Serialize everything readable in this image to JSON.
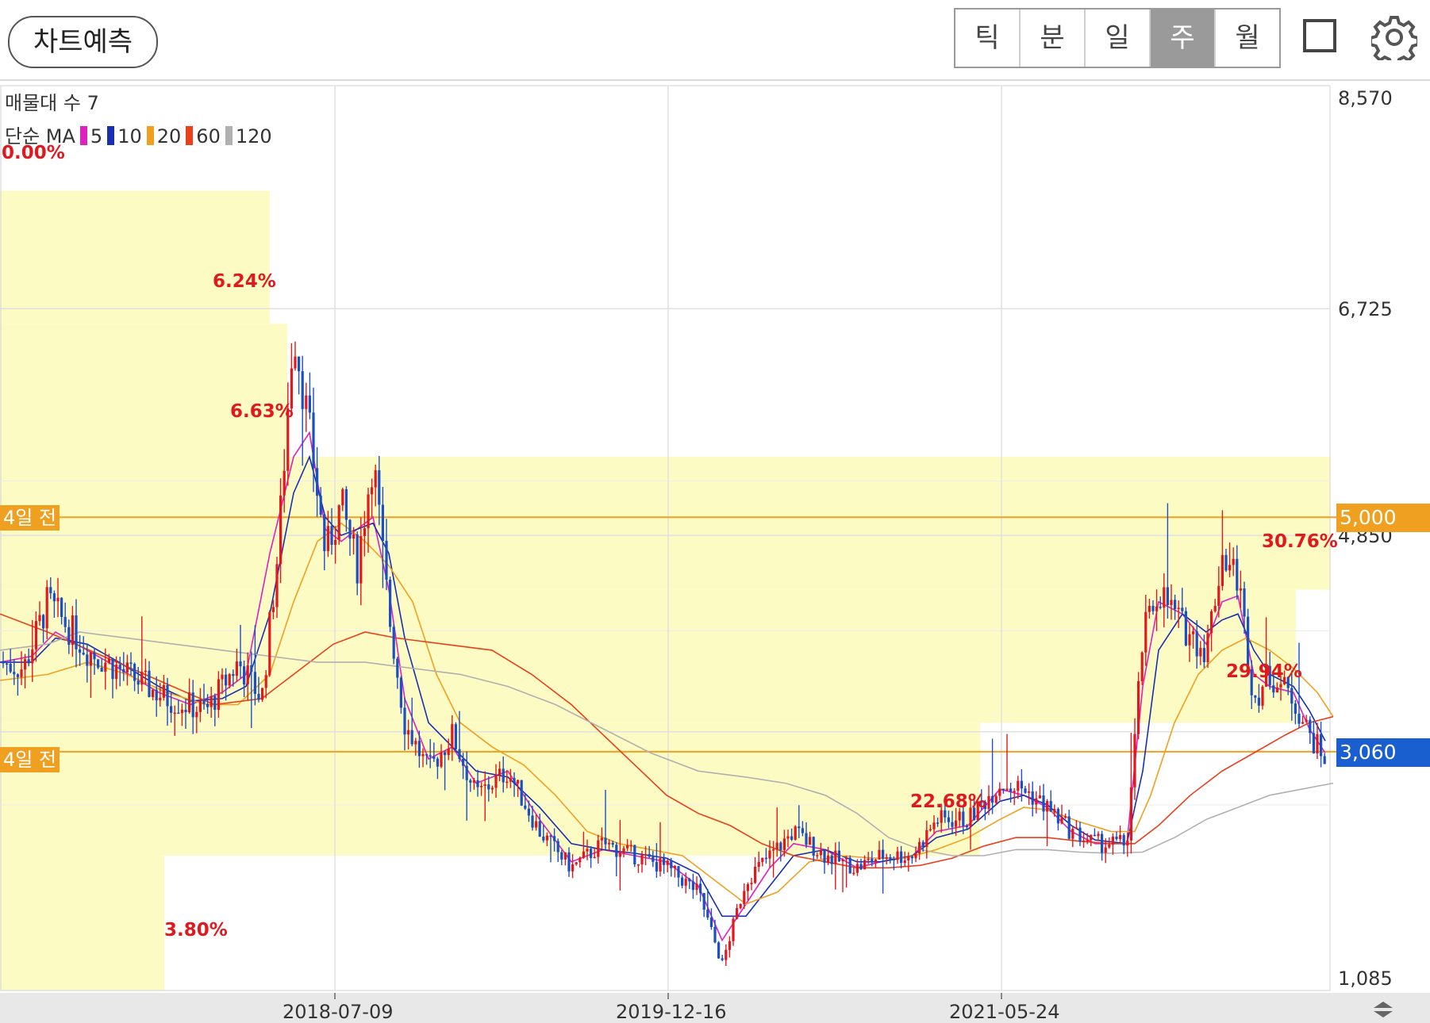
{
  "header": {
    "predict_button": "차트예측",
    "tabs": [
      {
        "label": "틱",
        "active": false
      },
      {
        "label": "분",
        "active": false
      },
      {
        "label": "일",
        "active": false
      },
      {
        "label": "주",
        "active": true
      },
      {
        "label": "월",
        "active": false
      }
    ],
    "icons": [
      "square-icon",
      "gear-icon"
    ]
  },
  "legend": {
    "volume_profile": "매물대 수 7",
    "ma_prefix": "단순 MA",
    "ma": [
      {
        "period": "5",
        "color": "#e020c0"
      },
      {
        "period": "10",
        "color": "#1a2fb0"
      },
      {
        "period": "20",
        "color": "#f0a020"
      },
      {
        "period": "60",
        "color": "#e8401a"
      },
      {
        "period": "120",
        "color": "#b0b0b0"
      }
    ]
  },
  "tags": {
    "upper_ago": "4일 전",
    "lower_ago": "4일 전",
    "upper_price": "5,000",
    "current_price": "3,060"
  },
  "colors": {
    "up": "#e0191f",
    "down": "#1b4fc4",
    "volume_zone": "#fdfbc4",
    "tag_orange": "#f0a020",
    "tag_blue": "#1a5fd0"
  },
  "chart_data": {
    "type": "candlestick",
    "interval": "weekly",
    "y_axis": {
      "min": 1085,
      "max": 8570,
      "ticks": [
        "8,570",
        "6,725",
        "4,850",
        "1,085"
      ]
    },
    "x_axis": {
      "ticks": [
        "2018-07-09",
        "2019-12-16",
        "2021-05-24"
      ]
    },
    "reference_lines": [
      5000,
      3060
    ],
    "volume_profile": [
      {
        "low": 1085,
        "high": 2200,
        "pct": "3.80%"
      },
      {
        "low": 2200,
        "high": 3300,
        "pct": "22.68%"
      },
      {
        "low": 3300,
        "high": 4400,
        "pct": "29.94%"
      },
      {
        "low": 4400,
        "high": 5500,
        "pct": "30.76%"
      },
      {
        "low": 5500,
        "high": 6600,
        "pct": "6.63%"
      },
      {
        "low": 6600,
        "high": 7700,
        "pct": "6.24%"
      },
      {
        "low": 7700,
        "high": 8570,
        "pct": "0.00%"
      }
    ],
    "price_path": [
      [
        0,
        3800
      ],
      [
        30,
        3750
      ],
      [
        60,
        4300
      ],
      [
        110,
        3900
      ],
      [
        160,
        3700
      ],
      [
        210,
        3500
      ],
      [
        260,
        3400
      ],
      [
        300,
        3800
      ],
      [
        330,
        3500
      ],
      [
        350,
        4700
      ],
      [
        370,
        6600
      ],
      [
        390,
        5700
      ],
      [
        410,
        4700
      ],
      [
        430,
        5100
      ],
      [
        450,
        4600
      ],
      [
        470,
        5500
      ],
      [
        490,
        4200
      ],
      [
        510,
        3300
      ],
      [
        540,
        2900
      ],
      [
        570,
        3200
      ],
      [
        600,
        2700
      ],
      [
        640,
        2900
      ],
      [
        680,
        2400
      ],
      [
        720,
        2100
      ],
      [
        760,
        2300
      ],
      [
        800,
        2200
      ],
      [
        840,
        2100
      ],
      [
        880,
        1900
      ],
      [
        910,
        1300
      ],
      [
        940,
        2000
      ],
      [
        970,
        2200
      ],
      [
        1000,
        2400
      ],
      [
        1040,
        2200
      ],
      [
        1080,
        2100
      ],
      [
        1110,
        2200
      ],
      [
        1150,
        2200
      ],
      [
        1180,
        2500
      ],
      [
        1220,
        2500
      ],
      [
        1260,
        2800
      ],
      [
        1290,
        2750
      ],
      [
        1320,
        2600
      ],
      [
        1350,
        2400
      ],
      [
        1380,
        2300
      ],
      [
        1420,
        2300
      ],
      [
        1440,
        4000
      ],
      [
        1460,
        4400
      ],
      [
        1490,
        4100
      ],
      [
        1520,
        3900
      ],
      [
        1540,
        4700
      ],
      [
        1560,
        4500
      ],
      [
        1580,
        3500
      ],
      [
        1600,
        3700
      ],
      [
        1630,
        3500
      ],
      [
        1650,
        3200
      ],
      [
        1670,
        3000
      ]
    ],
    "moving_averages": {
      "ma5": [
        [
          0,
          3800
        ],
        [
          40,
          3850
        ],
        [
          70,
          4050
        ],
        [
          110,
          3900
        ],
        [
          150,
          3750
        ],
        [
          200,
          3550
        ],
        [
          240,
          3450
        ],
        [
          280,
          3550
        ],
        [
          310,
          3700
        ],
        [
          340,
          4700
        ],
        [
          370,
          5500
        ],
        [
          390,
          5700
        ],
        [
          410,
          4900
        ],
        [
          430,
          4800
        ],
        [
          450,
          4900
        ],
        [
          470,
          5000
        ],
        [
          490,
          4400
        ],
        [
          510,
          3500
        ],
        [
          540,
          3000
        ],
        [
          570,
          3100
        ],
        [
          600,
          2800
        ],
        [
          640,
          2900
        ],
        [
          680,
          2500
        ],
        [
          720,
          2150
        ],
        [
          760,
          2250
        ],
        [
          800,
          2200
        ],
        [
          840,
          2150
        ],
        [
          880,
          1950
        ],
        [
          910,
          1500
        ],
        [
          940,
          1800
        ],
        [
          970,
          2100
        ],
        [
          1000,
          2300
        ],
        [
          1040,
          2250
        ],
        [
          1080,
          2100
        ],
        [
          1110,
          2150
        ],
        [
          1150,
          2200
        ],
        [
          1180,
          2400
        ],
        [
          1220,
          2450
        ],
        [
          1260,
          2750
        ],
        [
          1290,
          2700
        ],
        [
          1320,
          2600
        ],
        [
          1350,
          2400
        ],
        [
          1380,
          2300
        ],
        [
          1420,
          2300
        ],
        [
          1440,
          3600
        ],
        [
          1460,
          4300
        ],
        [
          1490,
          4200
        ],
        [
          1520,
          3950
        ],
        [
          1540,
          4300
        ],
        [
          1560,
          4350
        ],
        [
          1580,
          3700
        ],
        [
          1600,
          3600
        ],
        [
          1630,
          3550
        ],
        [
          1650,
          3250
        ],
        [
          1670,
          3050
        ]
      ],
      "ma10": [
        [
          0,
          3800
        ],
        [
          40,
          3800
        ],
        [
          70,
          4000
        ],
        [
          110,
          3950
        ],
        [
          150,
          3800
        ],
        [
          200,
          3600
        ],
        [
          240,
          3480
        ],
        [
          280,
          3500
        ],
        [
          310,
          3600
        ],
        [
          340,
          4200
        ],
        [
          370,
          5200
        ],
        [
          390,
          5500
        ],
        [
          410,
          5000
        ],
        [
          430,
          4850
        ],
        [
          450,
          4900
        ],
        [
          470,
          4950
        ],
        [
          490,
          4700
        ],
        [
          510,
          4000
        ],
        [
          540,
          3300
        ],
        [
          570,
          3100
        ],
        [
          600,
          2900
        ],
        [
          640,
          2850
        ],
        [
          680,
          2600
        ],
        [
          720,
          2300
        ],
        [
          760,
          2250
        ],
        [
          800,
          2220
        ],
        [
          840,
          2180
        ],
        [
          880,
          2050
        ],
        [
          910,
          1700
        ],
        [
          940,
          1700
        ],
        [
          970,
          1950
        ],
        [
          1000,
          2200
        ],
        [
          1040,
          2250
        ],
        [
          1080,
          2150
        ],
        [
          1110,
          2150
        ],
        [
          1150,
          2200
        ],
        [
          1180,
          2350
        ],
        [
          1220,
          2420
        ],
        [
          1260,
          2650
        ],
        [
          1290,
          2700
        ],
        [
          1320,
          2620
        ],
        [
          1350,
          2450
        ],
        [
          1380,
          2330
        ],
        [
          1420,
          2300
        ],
        [
          1440,
          2900
        ],
        [
          1460,
          3900
        ],
        [
          1490,
          4200
        ],
        [
          1520,
          4050
        ],
        [
          1540,
          4150
        ],
        [
          1560,
          4200
        ],
        [
          1580,
          3900
        ],
        [
          1600,
          3700
        ],
        [
          1630,
          3600
        ],
        [
          1650,
          3400
        ],
        [
          1670,
          3150
        ]
      ],
      "ma20": [
        [
          0,
          3650
        ],
        [
          60,
          3700
        ],
        [
          110,
          3800
        ],
        [
          160,
          3700
        ],
        [
          210,
          3550
        ],
        [
          260,
          3450
        ],
        [
          300,
          3450
        ],
        [
          340,
          3700
        ],
        [
          370,
          4300
        ],
        [
          400,
          4800
        ],
        [
          430,
          4950
        ],
        [
          460,
          4800
        ],
        [
          490,
          4600
        ],
        [
          520,
          4300
        ],
        [
          550,
          3700
        ],
        [
          580,
          3300
        ],
        [
          620,
          3100
        ],
        [
          660,
          2950
        ],
        [
          700,
          2700
        ],
        [
          740,
          2400
        ],
        [
          780,
          2300
        ],
        [
          820,
          2250
        ],
        [
          860,
          2200
        ],
        [
          900,
          2000
        ],
        [
          940,
          1800
        ],
        [
          980,
          1900
        ],
        [
          1020,
          2150
        ],
        [
          1060,
          2200
        ],
        [
          1100,
          2180
        ],
        [
          1140,
          2180
        ],
        [
          1180,
          2250
        ],
        [
          1220,
          2350
        ],
        [
          1260,
          2500
        ],
        [
          1290,
          2600
        ],
        [
          1320,
          2580
        ],
        [
          1360,
          2480
        ],
        [
          1400,
          2400
        ],
        [
          1430,
          2400
        ],
        [
          1450,
          2700
        ],
        [
          1480,
          3300
        ],
        [
          1510,
          3700
        ],
        [
          1540,
          3900
        ],
        [
          1570,
          4000
        ],
        [
          1600,
          3900
        ],
        [
          1630,
          3750
        ],
        [
          1660,
          3550
        ],
        [
          1680,
          3350
        ]
      ],
      "ma60": [
        [
          0,
          4200
        ],
        [
          60,
          4050
        ],
        [
          130,
          3850
        ],
        [
          200,
          3650
        ],
        [
          270,
          3450
        ],
        [
          330,
          3500
        ],
        [
          380,
          3750
        ],
        [
          420,
          3950
        ],
        [
          460,
          4050
        ],
        [
          500,
          4000
        ],
        [
          560,
          3950
        ],
        [
          620,
          3900
        ],
        [
          670,
          3700
        ],
        [
          720,
          3450
        ],
        [
          760,
          3200
        ],
        [
          800,
          2950
        ],
        [
          840,
          2700
        ],
        [
          880,
          2550
        ],
        [
          920,
          2450
        ],
        [
          960,
          2300
        ],
        [
          1000,
          2200
        ],
        [
          1040,
          2150
        ],
        [
          1080,
          2100
        ],
        [
          1120,
          2100
        ],
        [
          1160,
          2120
        ],
        [
          1200,
          2180
        ],
        [
          1240,
          2280
        ],
        [
          1280,
          2350
        ],
        [
          1320,
          2350
        ],
        [
          1360,
          2320
        ],
        [
          1400,
          2300
        ],
        [
          1430,
          2300
        ],
        [
          1460,
          2450
        ],
        [
          1500,
          2700
        ],
        [
          1540,
          2900
        ],
        [
          1580,
          3050
        ],
        [
          1620,
          3200
        ],
        [
          1650,
          3300
        ],
        [
          1680,
          3350
        ]
      ],
      "ma120": [
        [
          0,
          3900
        ],
        [
          60,
          3950
        ],
        [
          100,
          4050
        ],
        [
          160,
          4000
        ],
        [
          220,
          3950
        ],
        [
          280,
          3900
        ],
        [
          340,
          3850
        ],
        [
          400,
          3800
        ],
        [
          460,
          3800
        ],
        [
          520,
          3750
        ],
        [
          580,
          3700
        ],
        [
          640,
          3600
        ],
        [
          700,
          3450
        ],
        [
          760,
          3250
        ],
        [
          820,
          3050
        ],
        [
          880,
          2900
        ],
        [
          940,
          2850
        ],
        [
          990,
          2800
        ],
        [
          1040,
          2700
        ],
        [
          1080,
          2550
        ],
        [
          1120,
          2350
        ],
        [
          1160,
          2250
        ],
        [
          1200,
          2200
        ],
        [
          1240,
          2200
        ],
        [
          1280,
          2250
        ],
        [
          1320,
          2250
        ],
        [
          1360,
          2230
        ],
        [
          1400,
          2220
        ],
        [
          1440,
          2230
        ],
        [
          1480,
          2350
        ],
        [
          1520,
          2500
        ],
        [
          1560,
          2600
        ],
        [
          1600,
          2700
        ],
        [
          1640,
          2750
        ],
        [
          1680,
          2800
        ]
      ]
    }
  }
}
